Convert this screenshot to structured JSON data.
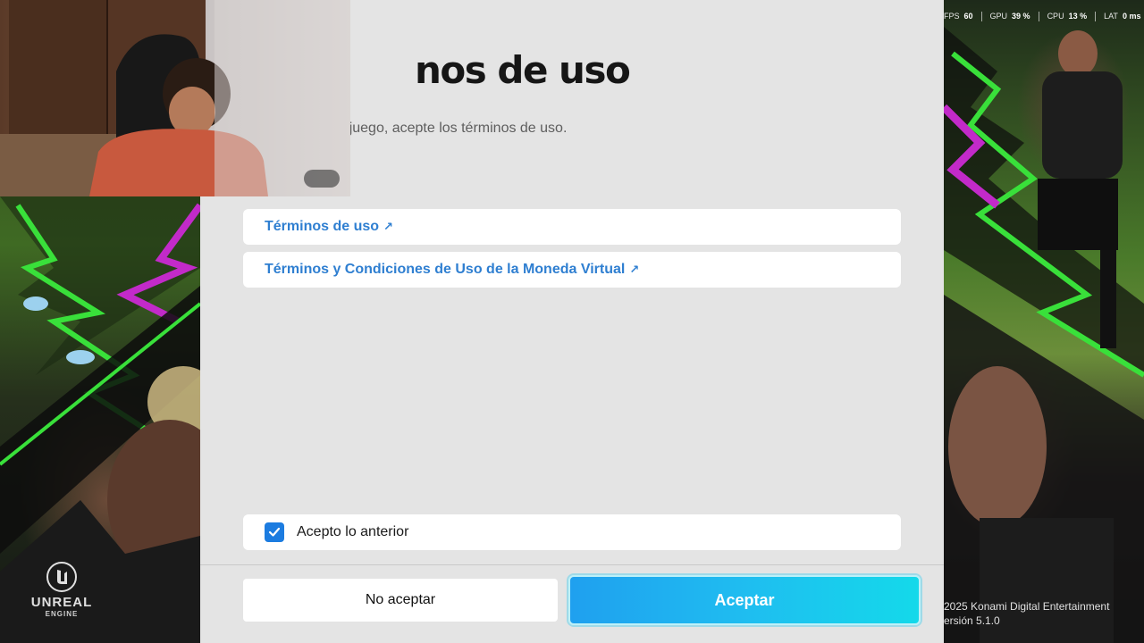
{
  "perf_overlay": {
    "items": [
      {
        "label": "FPS",
        "value": "60"
      },
      {
        "label": "GPU",
        "value": "39 %"
      },
      {
        "label": "CPU",
        "value": "13 %"
      },
      {
        "label": "LAT",
        "value": "0 ms"
      }
    ]
  },
  "dialog": {
    "title": "nos de uso",
    "subtitle": "este juego, acepte los términos de uso.",
    "links": [
      {
        "label": "Términos de uso",
        "icon": "external-link-icon"
      },
      {
        "label": "Términos y Condiciones de Uso de la Moneda Virtual",
        "icon": "external-link-icon"
      }
    ],
    "accept_checkbox": {
      "label": "Acepto lo anterior",
      "checked": true
    },
    "buttons": {
      "decline": "No aceptar",
      "accept": "Aceptar"
    }
  },
  "branding": {
    "engine_word": "UNREAL",
    "engine_sub": "ENGINE",
    "copyright_line1": "2025 Konami Digital Entertainment",
    "version": "ersión 5.1.0"
  },
  "colors": {
    "panel_bg": "#e4e4e4",
    "link": "#2f7fd1",
    "checkbox": "#1c7ce0",
    "accept_gradient_start": "#1fa0ef",
    "accept_gradient_end": "#14d9ea"
  }
}
